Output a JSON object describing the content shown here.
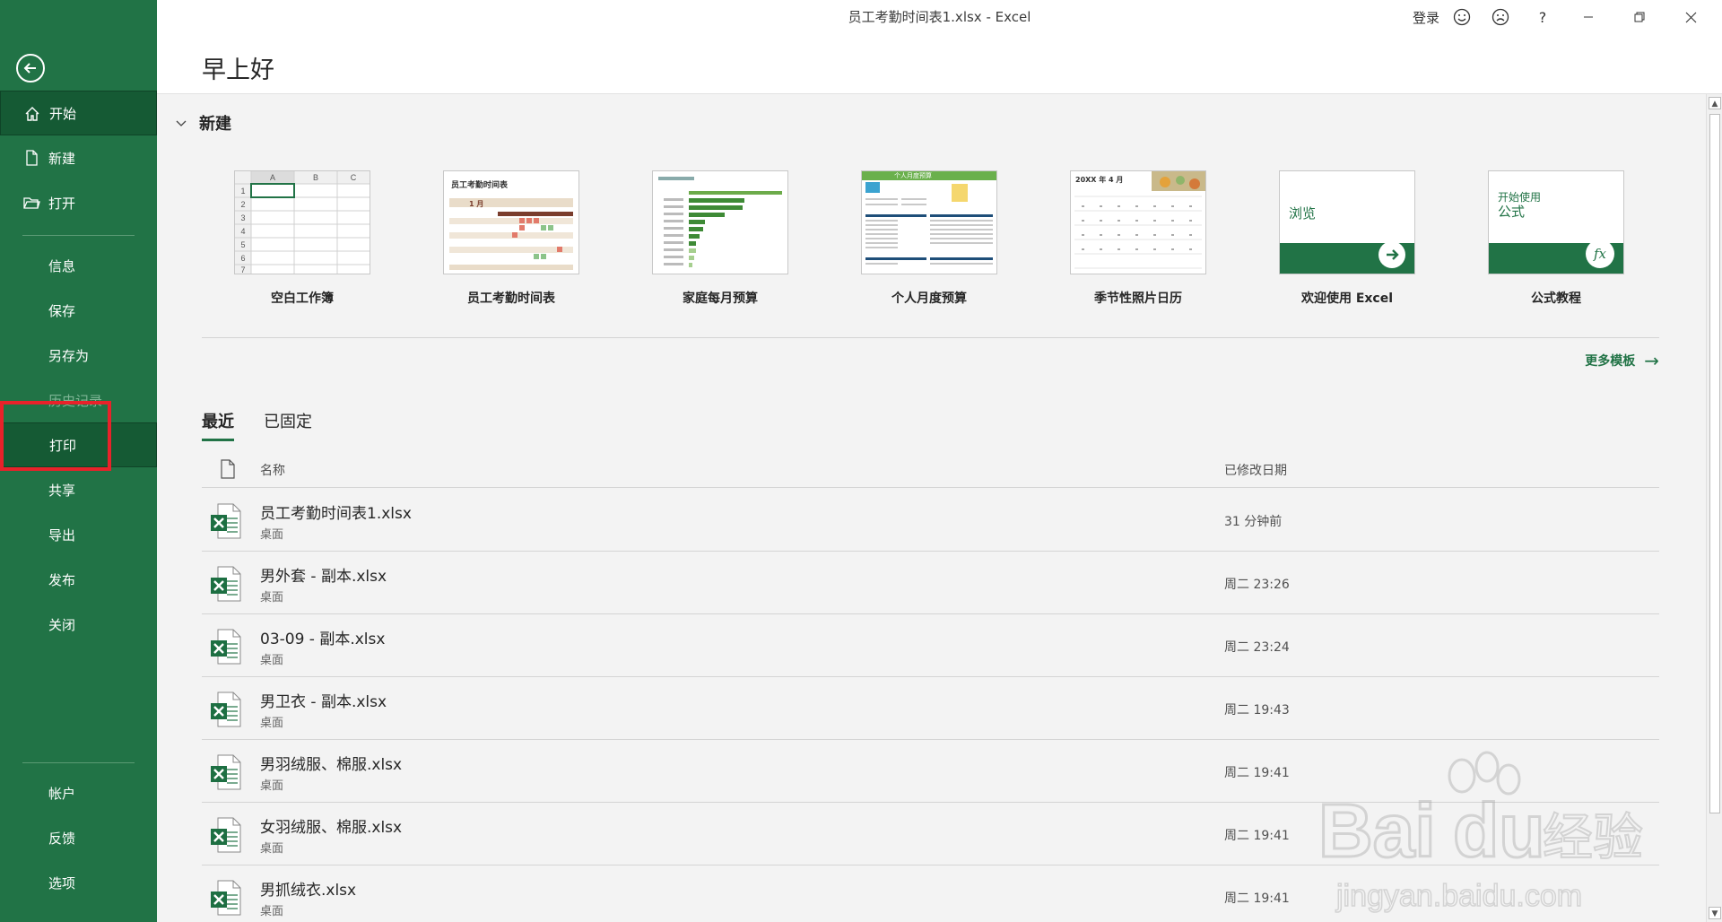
{
  "window": {
    "title": "员工考勤时间表1.xlsx  -  Excel",
    "signin_label": "登录",
    "help_label": "?"
  },
  "sidebar": {
    "items": [
      {
        "label": "开始",
        "icon": "home-icon"
      },
      {
        "label": "新建",
        "icon": "new-document-icon"
      },
      {
        "label": "打开",
        "icon": "open-folder-icon"
      },
      {
        "label": "信息"
      },
      {
        "label": "保存"
      },
      {
        "label": "另存为"
      },
      {
        "label": "历史记录"
      },
      {
        "label": "打印"
      },
      {
        "label": "共享"
      },
      {
        "label": "导出"
      },
      {
        "label": "发布"
      },
      {
        "label": "关闭"
      },
      {
        "label": "帐户"
      },
      {
        "label": "反馈"
      },
      {
        "label": "选项"
      }
    ]
  },
  "main": {
    "greeting": "早上好",
    "new_section": {
      "title": "新建",
      "templates": [
        {
          "name": "空白工作簿"
        },
        {
          "name": "员工考勤时间表",
          "thumb_title": "员工考勤时间表",
          "thumb_sub": "1 月"
        },
        {
          "name": "家庭每月预算"
        },
        {
          "name": "个人月度预算",
          "thumb_title": "个人月度预算"
        },
        {
          "name": "季节性照片日历",
          "thumb_title": "20XX 年 4 月"
        },
        {
          "name": "欢迎使用 Excel",
          "thumb_title": "浏览"
        },
        {
          "name": "公式教程",
          "thumb_title": "开始使用",
          "thumb_sub": "公式"
        }
      ],
      "blank_grid": {
        "cols": [
          "A",
          "B",
          "C"
        ],
        "rows": [
          "1",
          "2",
          "3",
          "4",
          "5",
          "6",
          "7"
        ]
      },
      "more_label": "更多模板"
    },
    "tabs": [
      {
        "label": "最近"
      },
      {
        "label": "已固定"
      }
    ],
    "list": {
      "col_name": "名称",
      "col_date": "已修改日期",
      "files": [
        {
          "name": "员工考勤时间表1.xlsx",
          "location": "桌面",
          "modified": "31 分钟前"
        },
        {
          "name": "男外套 - 副本.xlsx",
          "location": "桌面",
          "modified": "周二 23:26"
        },
        {
          "name": "03-09 - 副本.xlsx",
          "location": "桌面",
          "modified": "周二 23:24"
        },
        {
          "name": "男卫衣 - 副本.xlsx",
          "location": "桌面",
          "modified": "周二 19:43"
        },
        {
          "name": "男羽绒服、棉服.xlsx",
          "location": "桌面",
          "modified": "周二 19:41"
        },
        {
          "name": "女羽绒服、棉服.xlsx",
          "location": "桌面",
          "modified": "周二 19:41"
        },
        {
          "name": "男抓绒衣.xlsx",
          "location": "桌面",
          "modified": "周二 19:41"
        }
      ]
    }
  },
  "watermark": {
    "brand": "Bai",
    "brand2": "du",
    "cn": "经验",
    "url": "jingyan.baidu.com"
  },
  "colors": {
    "accent": "#217346",
    "highlight": "#e8222a"
  }
}
